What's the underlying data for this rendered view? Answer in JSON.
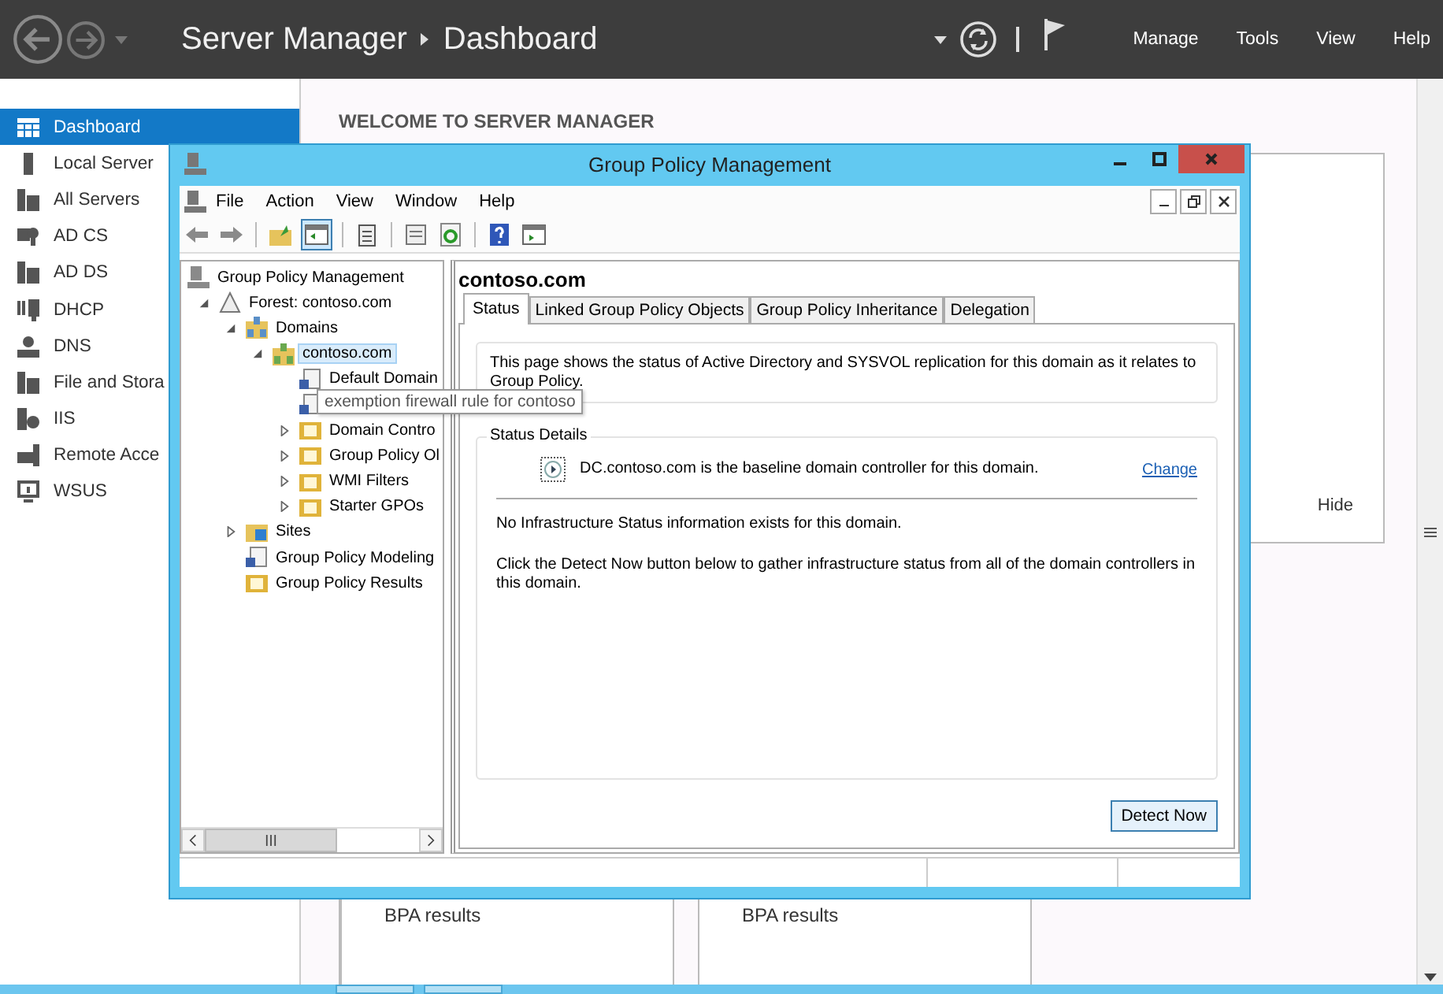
{
  "server_manager": {
    "title": "Server Manager",
    "breadcrumb": "Dashboard",
    "menu": [
      "Manage",
      "Tools",
      "View",
      "Help"
    ]
  },
  "sidebar": {
    "items": [
      {
        "label": "Dashboard",
        "selected": true
      },
      {
        "label": "Local Server",
        "selected": false
      },
      {
        "label": "All Servers",
        "selected": false
      },
      {
        "label": "AD CS",
        "selected": false
      },
      {
        "label": "AD DS",
        "selected": false
      },
      {
        "label": "DHCP",
        "selected": false
      },
      {
        "label": "DNS",
        "selected": false
      },
      {
        "label": "File and Stora",
        "selected": false
      },
      {
        "label": "IIS",
        "selected": false
      },
      {
        "label": "Remote Acce",
        "selected": false
      },
      {
        "label": "WSUS",
        "selected": false
      }
    ]
  },
  "welcome": {
    "title": "WELCOME TO SERVER MANAGER",
    "hide_link": "Hide"
  },
  "tiles": [
    {
      "label": "BPA results"
    },
    {
      "label": "BPA results"
    }
  ],
  "gpm_window": {
    "title": "Group Policy Management",
    "menu": [
      "File",
      "Action",
      "View",
      "Window",
      "Help"
    ],
    "tree": [
      {
        "label": "Group Policy Management",
        "kind": "root",
        "selected": false,
        "children": [
          {
            "label": "Forest: contoso.com",
            "kind": "forest",
            "selected": false,
            "expanded": true,
            "children": [
              {
                "label": "Domains",
                "kind": "container",
                "selected": false,
                "expanded": true,
                "children": [
                  {
                    "label": "contoso.com",
                    "kind": "domain",
                    "selected": true,
                    "expanded": true,
                    "children": [
                      {
                        "label": "Default Domain",
                        "kind": "link",
                        "selected": false
                      },
                      {
                        "kind": "link",
                        "selected": false
                      },
                      {
                        "label": "Domain Contro",
                        "kind": "folder",
                        "selected": false,
                        "expanded": false
                      },
                      {
                        "label": "Group Policy Ol",
                        "kind": "folder",
                        "selected": false,
                        "expanded": false
                      },
                      {
                        "label": "WMI Filters",
                        "kind": "folder",
                        "selected": false,
                        "expanded": false
                      },
                      {
                        "label": "Starter GPOs",
                        "kind": "folder",
                        "selected": false,
                        "expanded": false
                      }
                    ]
                  }
                ]
              },
              {
                "label": "Sites",
                "kind": "sites",
                "selected": false,
                "expanded": false
              },
              {
                "label": "Group Policy Modeling",
                "kind": "link",
                "selected": false
              },
              {
                "label": "Group Policy Results",
                "kind": "folder",
                "selected": false
              }
            ]
          }
        ]
      }
    ],
    "tooltip": "exemption firewall rule for contoso",
    "detail": {
      "title": "contoso.com",
      "tabs": [
        {
          "label": "Status",
          "selected": true
        },
        {
          "label": "Linked Group Policy Objects",
          "selected": false
        },
        {
          "label": "Group Policy Inheritance",
          "selected": false
        },
        {
          "label": "Delegation",
          "selected": false
        }
      ],
      "description": "This page shows the status of Active Directory and SYSVOL replication for this domain as it relates to Group Policy.",
      "group_title": "Status Details",
      "baseline": "DC.contoso.com is the baseline domain controller for this domain.",
      "change_link": "Change",
      "info": "No Infrastructure Status information exists for this domain.",
      "instructions": "Click the Detect Now button below to gather infrastructure status from all of the domain controllers in this domain.",
      "button": "Detect Now"
    }
  }
}
